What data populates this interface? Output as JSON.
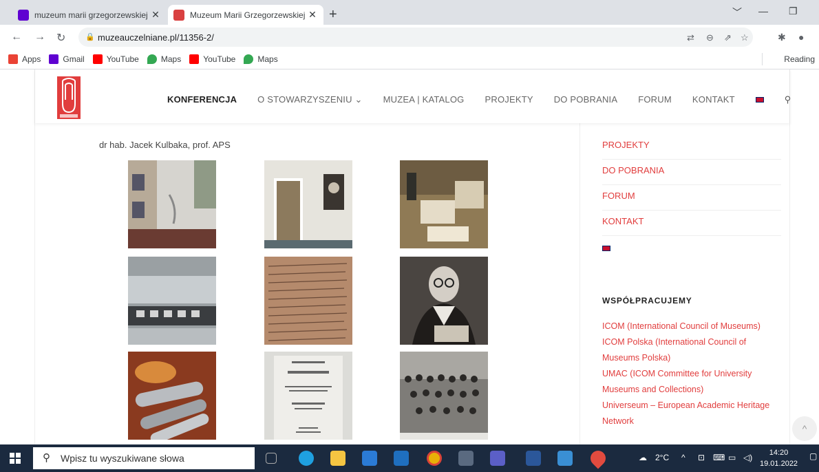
{
  "browser": {
    "tabs": [
      {
        "title": "muzeum marii grzegorzewskiej –",
        "close": "✕"
      },
      {
        "title": "Muzeum Marii Grzegorzewskiej |",
        "close": "✕"
      }
    ],
    "new_tab": "+",
    "window_controls": [
      "﹀",
      "—",
      "❐"
    ],
    "url": "muzeauczelniane.pl/11356-2/",
    "bookmarks": [
      {
        "label": "Apps",
        "icon": "apps-grid-icon",
        "color": "#ea4335"
      },
      {
        "label": "Gmail",
        "icon": "yahoo-icon",
        "color": "#5f01d1"
      },
      {
        "label": "YouTube",
        "icon": "youtube-icon",
        "color": "#ff0000"
      },
      {
        "label": "Maps",
        "icon": "maps-pin-icon",
        "color": "#34a853"
      },
      {
        "label": "YouTube",
        "icon": "youtube-icon",
        "color": "#ff0000"
      },
      {
        "label": "Maps",
        "icon": "maps-pin-icon",
        "color": "#34a853"
      }
    ],
    "reading_list": "Reading"
  },
  "site": {
    "nav": [
      "KONFERENCJA",
      "O STOWARZYSZENIU ⌄",
      "MUZEA | KATALOG",
      "PROJEKTY",
      "DO POBRANIA",
      "FORUM",
      "KONTAKT"
    ],
    "accent": "#e13d3d"
  },
  "content": {
    "author": "dr hab. Jacek Kulbaka, prof. APS"
  },
  "sidebar": {
    "links": [
      "PROJEKTY",
      "DO POBRANIA",
      "FORUM",
      "KONTAKT"
    ],
    "heading": "WSPÓŁPRACUJEMY",
    "partners": [
      "ICOM (International Council of Museums)",
      "ICOM Polska (International Council of Museums Polska)",
      "UMAC (ICOM Committee for University Museums and Collections)",
      "Universeum – European Academic Heritage Network"
    ]
  },
  "taskbar": {
    "search_placeholder": "Wpisz tu wyszukiwane słowa",
    "weather": "2°C",
    "time": "14:20",
    "date": "19.01.2022",
    "color": "#1b2a3f"
  }
}
